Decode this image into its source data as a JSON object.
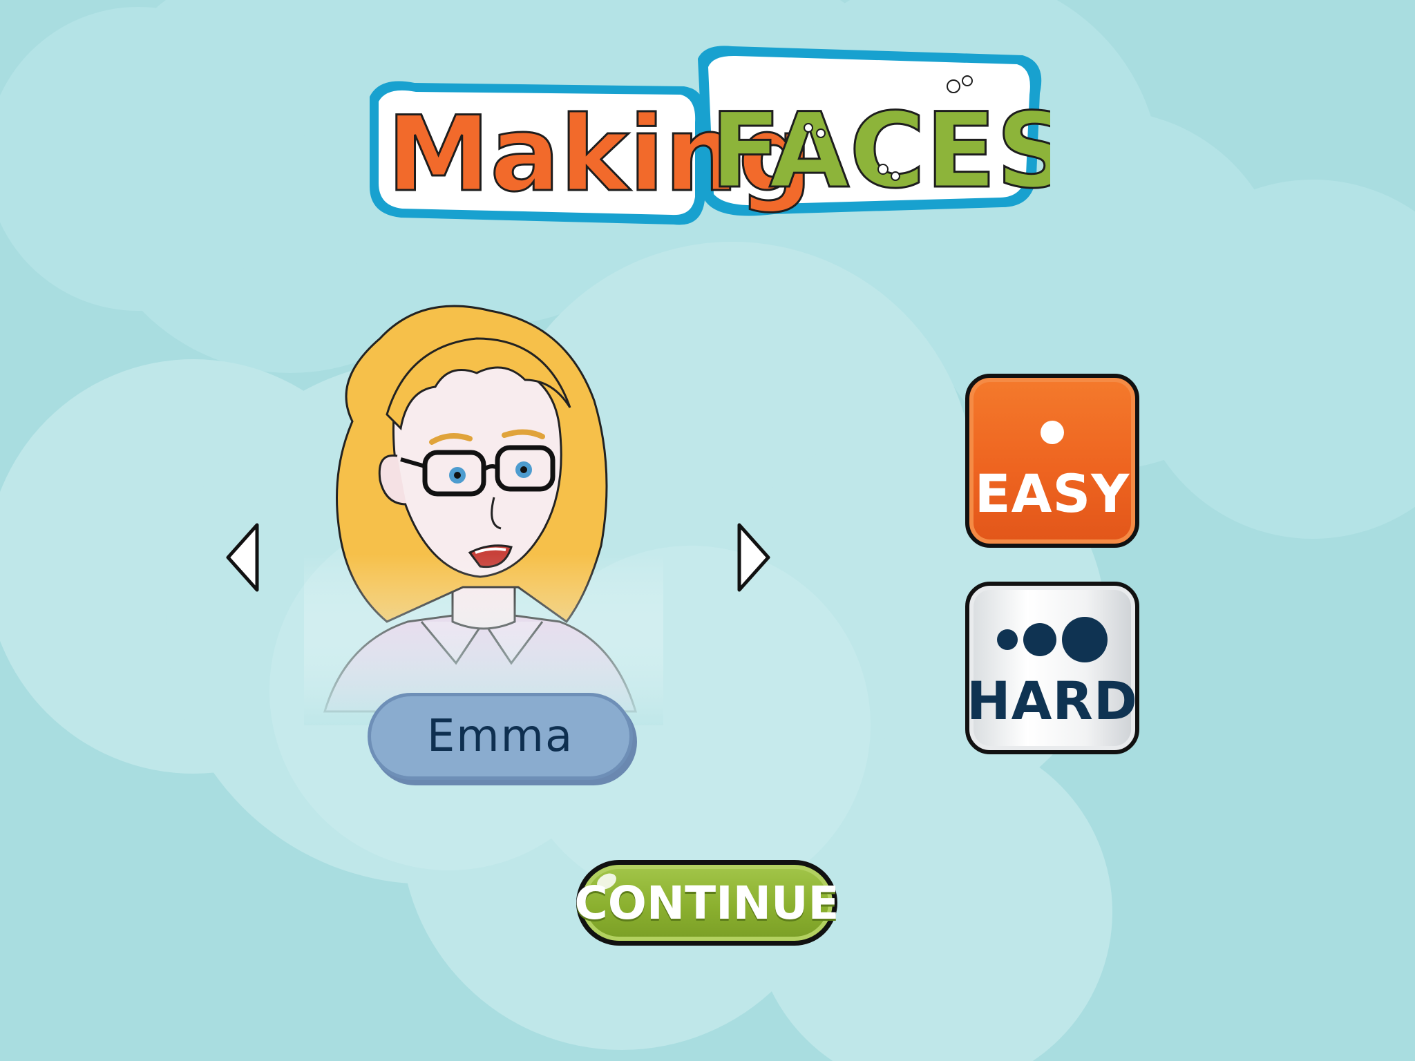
{
  "app": {
    "title_part1": "Making",
    "title_part2": "FACES"
  },
  "character": {
    "name": "Emma",
    "prev_icon": "triangle-left-icon",
    "next_icon": "triangle-right-icon"
  },
  "difficulty": {
    "easy_label": "EASY",
    "hard_label": "HARD",
    "selected": "EASY"
  },
  "actions": {
    "continue_label": "CONTINUE"
  },
  "colors": {
    "background": "#a9dde0",
    "easy": "#ee6420",
    "hard": "#f2f3f4",
    "continue": "#8bb02f",
    "logo_orange": "#f26a2b",
    "logo_green": "#8db43a",
    "logo_outline": "#18a1cf"
  }
}
